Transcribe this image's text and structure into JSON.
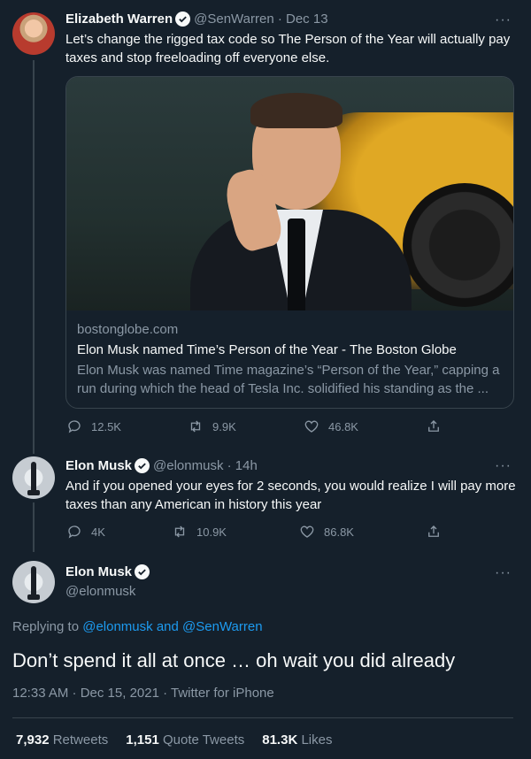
{
  "tweet1": {
    "name": "Elizabeth Warren",
    "handle": "@SenWarren · Dec 13",
    "text": "Let’s change the rigged tax code so The Person of the Year will actually pay taxes and stop freeloading off everyone else.",
    "card": {
      "domain": "bostonglobe.com",
      "title": "Elon Musk named Time’s Person of the Year - The Boston Globe",
      "description": "Elon Musk was named Time magazine’s “Person of the Year,” capping a run during which the head of Tesla Inc. solidified his standing as the ..."
    },
    "replies": "12.5K",
    "retweets": "9.9K",
    "likes": "46.8K"
  },
  "tweet2": {
    "name": "Elon Musk",
    "handle": "@elonmusk · 14h",
    "text": "And if you opened your eyes for 2 seconds, you would realize I will pay more taxes than any American in history this year",
    "replies": "4K",
    "retweets": "10.9K",
    "likes": "86.8K"
  },
  "main": {
    "name": "Elon Musk",
    "handle": "@elonmusk",
    "replying_prefix": "Replying to ",
    "reply_to_1": "@elonmusk",
    "reply_and": " and ",
    "reply_to_2": "@SenWarren",
    "text": "Don’t spend it all at once … oh wait you did already",
    "meta": "12:33 AM · Dec 15, 2021 · Twitter for iPhone",
    "stats": {
      "retweets_count": "7,932",
      "retweets_label": "Retweets",
      "quotes_count": "1,151",
      "quotes_label": "Quote Tweets",
      "likes_count": "81.3K",
      "likes_label": "Likes"
    }
  },
  "more_glyph": "···",
  "colors": {
    "background": "#15202b",
    "accent": "#1d9bf0",
    "muted": "#8b98a5",
    "border": "#38444d"
  },
  "icons": [
    "verified-badge-icon",
    "more-icon",
    "reply-icon",
    "retweet-icon",
    "like-icon",
    "share-icon"
  ]
}
